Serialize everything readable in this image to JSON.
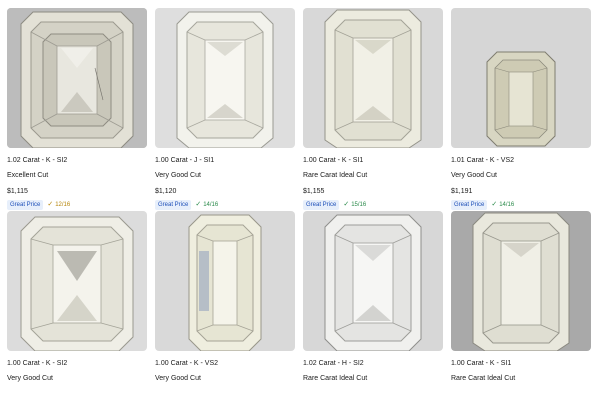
{
  "colors": {
    "badge_text": "#1d4fb8",
    "badge_bg": "#e7effb",
    "score_gold": "#b7860b",
    "score_green": "#2a8a4a"
  },
  "icons": {
    "score_check": "checkmark-icon"
  },
  "cards": [
    {
      "title": "1.02 Carat - K - SI2",
      "cut": "Excellent Cut",
      "price": "$1,115",
      "badge": "Great Price",
      "score": "12/16",
      "tone": "gold"
    },
    {
      "title": "1.00 Carat - J - SI1",
      "cut": "Very Good Cut",
      "price": "$1,120",
      "badge": "Great Price",
      "score": "14/16",
      "tone": "green"
    },
    {
      "title": "1.00 Carat - K - SI1",
      "cut": "Rare Carat Ideal Cut",
      "price": "$1,155",
      "badge": "Great Price",
      "score": "15/16",
      "tone": "green"
    },
    {
      "title": "1.01 Carat - K - VS2",
      "cut": "Very Good Cut",
      "price": "$1,191",
      "badge": "Great Price",
      "score": "14/16",
      "tone": "green"
    },
    {
      "title": "1.00 Carat - K - SI2",
      "cut": "Very Good Cut",
      "price": "",
      "badge": "",
      "score": "",
      "tone": ""
    },
    {
      "title": "1.00 Carat - K - VS2",
      "cut": "Very Good Cut",
      "price": "",
      "badge": "",
      "score": "",
      "tone": ""
    },
    {
      "title": "1.02 Carat - H - SI2",
      "cut": "Rare Carat Ideal Cut",
      "price": "",
      "badge": "",
      "score": "",
      "tone": ""
    },
    {
      "title": "1.00 Carat - K - SI1",
      "cut": "Rare Carat Ideal Cut",
      "price": "",
      "badge": "",
      "score": "",
      "tone": ""
    }
  ]
}
